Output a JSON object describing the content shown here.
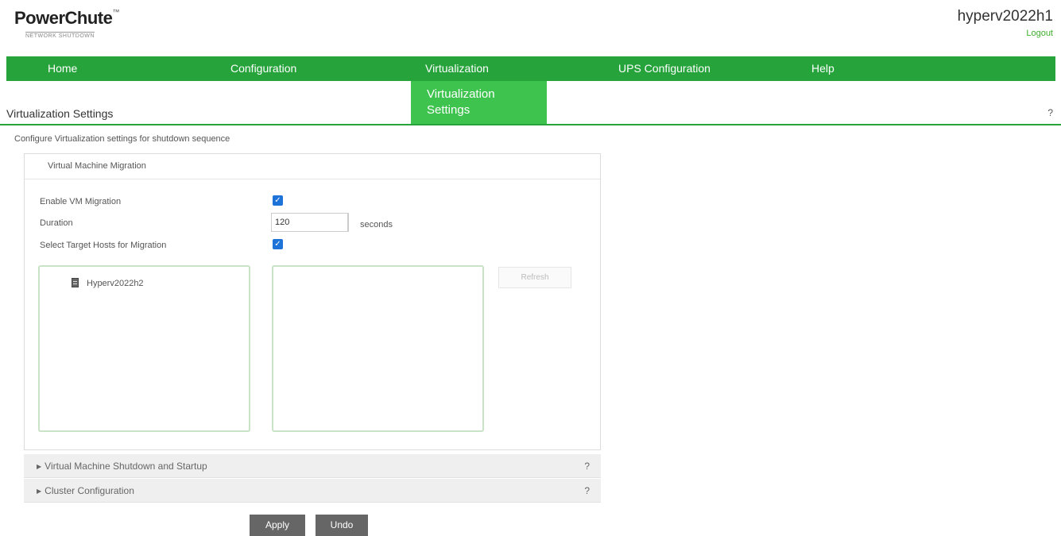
{
  "brand": {
    "logo": "PowerChute",
    "logo_mark": "™",
    "logo_subtitle": "NETWORK SHUTDOWN"
  },
  "header": {
    "hostname": "hyperv2022h1",
    "logout_label": "Logout"
  },
  "nav": {
    "items": [
      {
        "label": "Home"
      },
      {
        "label": "Configuration"
      },
      {
        "label": "Virtualization"
      },
      {
        "label": "UPS Configuration"
      },
      {
        "label": "Help"
      }
    ],
    "sub_item": {
      "line1": "Virtualization",
      "line2": "Settings"
    }
  },
  "page": {
    "title": "Virtualization Settings",
    "help": "?",
    "description": "Configure Virtualization settings for shutdown sequence"
  },
  "migration": {
    "header": "Virtual Machine Migration",
    "enable_label": "Enable VM Migration",
    "enable_checked": true,
    "duration_label": "Duration",
    "duration_value": "120",
    "duration_unit": "seconds",
    "select_targets_label": "Select Target Hosts for Migration",
    "select_targets_checked": true,
    "available_hosts": [
      "Hyperv2022h2"
    ],
    "selected_hosts": [],
    "refresh_label": "Refresh"
  },
  "sections": [
    {
      "label": "Virtual Machine Shutdown and Startup",
      "help": "?"
    },
    {
      "label": "Cluster Configuration",
      "help": "?"
    }
  ],
  "actions": {
    "apply_label": "Apply",
    "undo_label": "Undo"
  },
  "colors": {
    "nav_green": "#26a33b",
    "subnav_green": "#3ec34f",
    "link_green": "#3dae2b",
    "checkbox_blue": "#1e73d8",
    "button_gray": "#666666"
  },
  "icons": {
    "check": "checkmark-icon",
    "host": "server-icon",
    "expand": "triangle-right-icon"
  }
}
